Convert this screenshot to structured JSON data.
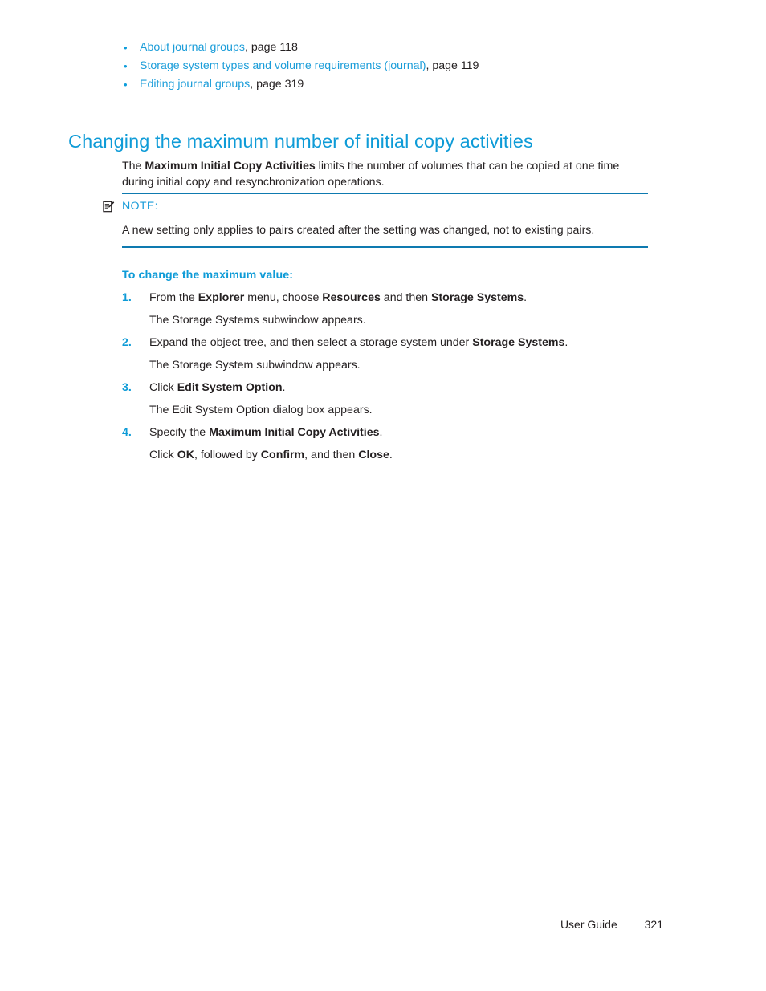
{
  "colors": {
    "heading_blue": "#0e9bd7",
    "link_blue": "#1b9dd9",
    "rule_blue": "#0e7ab0",
    "body_black": "#231f20"
  },
  "xref_list": {
    "bullet_glyph": "•",
    "items": [
      {
        "link": "About journal groups",
        "suffix": ", page 118"
      },
      {
        "link": "Storage system types and volume requirements (journal)",
        "suffix": ", page 119"
      },
      {
        "link": "Editing journal groups",
        "suffix": ", page 319"
      }
    ]
  },
  "section": {
    "heading": "Changing the maximum number of initial copy activities",
    "intro": {
      "before": "The ",
      "bold": "Maximum Initial Copy Activities",
      "after": " limits the number of volumes that can be copied at one time during initial copy and resynchronization operations."
    }
  },
  "note": {
    "icon": "note-icon",
    "label": "NOTE:",
    "body": "A new setting only applies to pairs created after the setting was changed, not to existing pairs."
  },
  "procedure": {
    "title": "To change the maximum value:",
    "steps": [
      {
        "number": "1.",
        "lines": [
          {
            "segments": [
              {
                "text": "From the ",
                "bold": false
              },
              {
                "text": "Explorer",
                "bold": true
              },
              {
                "text": " menu, choose ",
                "bold": false
              },
              {
                "text": "Resources",
                "bold": true
              },
              {
                "text": " and then ",
                "bold": false
              },
              {
                "text": "Storage Systems",
                "bold": true
              },
              {
                "text": ".",
                "bold": false
              }
            ]
          },
          {
            "segments": [
              {
                "text": "The Storage Systems subwindow appears.",
                "bold": false
              }
            ]
          }
        ]
      },
      {
        "number": "2.",
        "lines": [
          {
            "segments": [
              {
                "text": "Expand the object tree, and then select a storage system under ",
                "bold": false
              },
              {
                "text": "Storage Systems",
                "bold": true
              },
              {
                "text": ".",
                "bold": false
              }
            ]
          },
          {
            "segments": [
              {
                "text": "The Storage System subwindow appears.",
                "bold": false
              }
            ]
          }
        ]
      },
      {
        "number": "3.",
        "lines": [
          {
            "segments": [
              {
                "text": "Click ",
                "bold": false
              },
              {
                "text": "Edit System Option",
                "bold": true
              },
              {
                "text": ".",
                "bold": false
              }
            ]
          },
          {
            "segments": [
              {
                "text": "The Edit System Option dialog box appears.",
                "bold": false
              }
            ]
          }
        ]
      },
      {
        "number": "4.",
        "lines": [
          {
            "segments": [
              {
                "text": "Specify the ",
                "bold": false
              },
              {
                "text": "Maximum Initial Copy Activities",
                "bold": true
              },
              {
                "text": ".",
                "bold": false
              }
            ]
          },
          {
            "segments": [
              {
                "text": "Click ",
                "bold": false
              },
              {
                "text": "OK",
                "bold": true
              },
              {
                "text": ", followed by ",
                "bold": false
              },
              {
                "text": "Confirm",
                "bold": true
              },
              {
                "text": ", and then ",
                "bold": false
              },
              {
                "text": "Close",
                "bold": true
              },
              {
                "text": ".",
                "bold": false
              }
            ]
          }
        ]
      }
    ]
  },
  "footer": {
    "label": "User Guide",
    "page_number": "321"
  }
}
